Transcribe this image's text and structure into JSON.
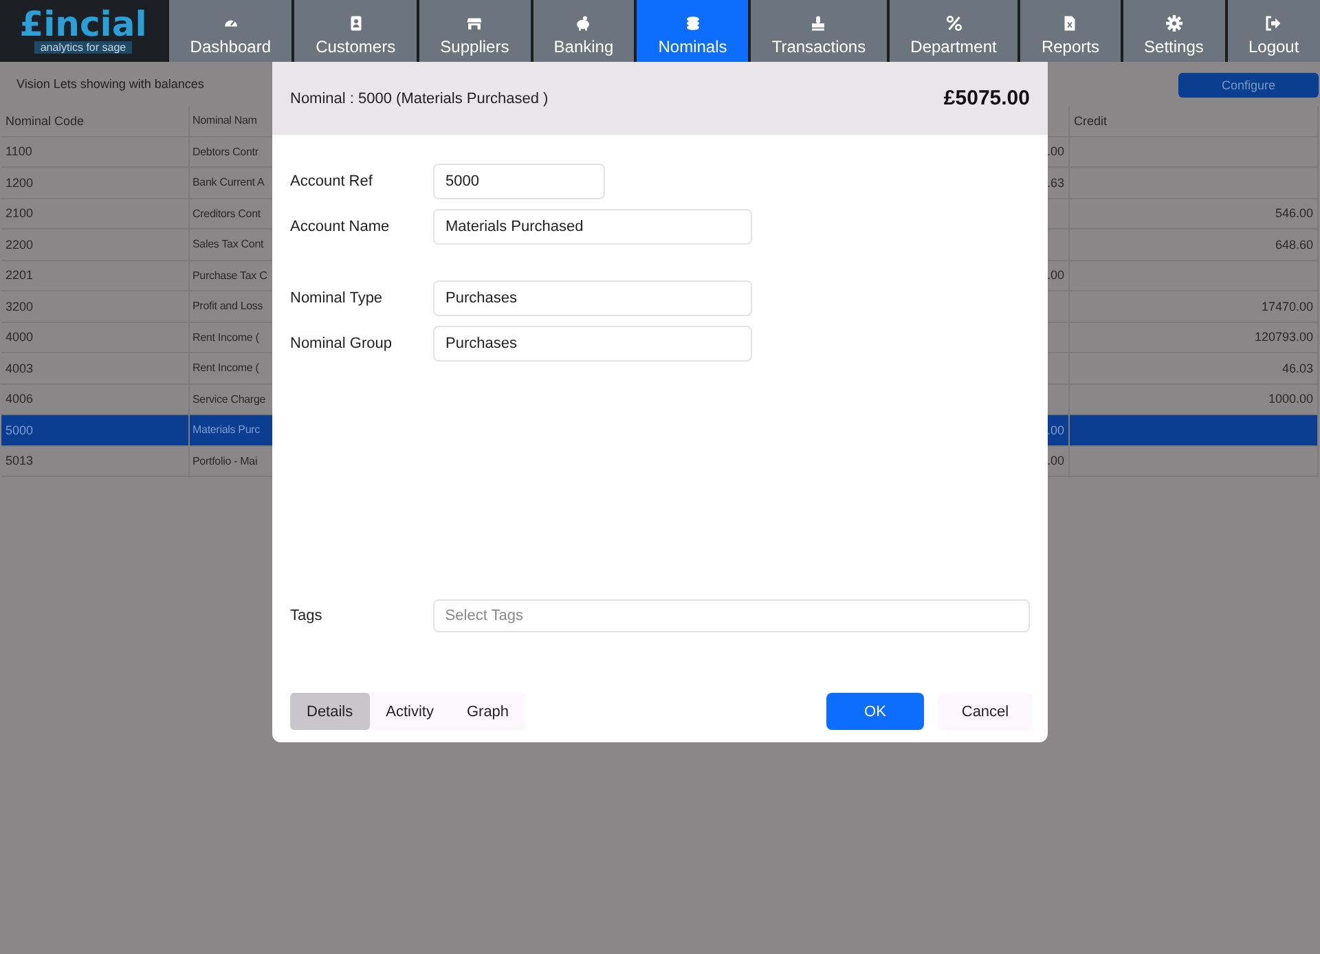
{
  "brand": {
    "name": "£incial",
    "tagline": "analytics for sage"
  },
  "nav": [
    {
      "label": "Dashboard",
      "selected": false
    },
    {
      "label": "Customers",
      "selected": false
    },
    {
      "label": "Suppliers",
      "selected": false
    },
    {
      "label": "Banking",
      "selected": false
    },
    {
      "label": "Nominals",
      "selected": true
    },
    {
      "label": "Transactions",
      "selected": false
    },
    {
      "label": "Department",
      "selected": false
    },
    {
      "label": "Reports",
      "selected": false
    },
    {
      "label": "Settings",
      "selected": false
    },
    {
      "label": "Logout",
      "selected": false
    }
  ],
  "toolbar": {
    "caption": "Vision Lets showing with balances",
    "button": "Configure"
  },
  "table": {
    "columns": [
      "Nominal Code",
      "Nominal Nam",
      "Credit"
    ],
    "rows": [
      {
        "code": "1100",
        "name": "Debtors Contr",
        "debit": ".00",
        "credit": "",
        "selected": false
      },
      {
        "code": "1200",
        "name": "Bank Current A",
        "debit": ".63",
        "credit": "",
        "selected": false
      },
      {
        "code": "2100",
        "name": "Creditors Cont",
        "debit": "",
        "credit": "546.00",
        "selected": false
      },
      {
        "code": "2200",
        "name": "Sales Tax Cont",
        "debit": "",
        "credit": "648.60",
        "selected": false
      },
      {
        "code": "2201",
        "name": "Purchase Tax C",
        "debit": ".00",
        "credit": "",
        "selected": false
      },
      {
        "code": "3200",
        "name": "Profit and Loss",
        "debit": "",
        "credit": "17470.00",
        "selected": false
      },
      {
        "code": "4000",
        "name": "Rent Income (",
        "debit": "",
        "credit": "120793.00",
        "selected": false
      },
      {
        "code": "4003",
        "name": "Rent Income (",
        "debit": "",
        "credit": "46.03",
        "selected": false
      },
      {
        "code": "4006",
        "name": "Service Charge",
        "debit": "",
        "credit": "1000.00",
        "selected": false
      },
      {
        "code": "5000",
        "name": "Materials Purc",
        "debit": ".00",
        "credit": "",
        "selected": true
      },
      {
        "code": "5013",
        "name": "Portfolio - Mai",
        "debit": ".00",
        "credit": "",
        "selected": false
      }
    ]
  },
  "dialog": {
    "title": "Nominal : 5000 (Materials Purchased )",
    "amount": "£5075.00",
    "fields": [
      {
        "label": "Account Ref",
        "value": "5000"
      },
      {
        "label": "Account Name",
        "value": "Materials Purchased"
      },
      {
        "label": "Nominal Type",
        "value": "Purchases"
      },
      {
        "label": "Nominal Group",
        "value": "Purchases"
      }
    ],
    "tags": {
      "label": "Tags",
      "placeholder": "Select Tags"
    },
    "tabs": [
      {
        "label": "Details",
        "selected": true
      },
      {
        "label": "Activity",
        "selected": false
      },
      {
        "label": "Graph",
        "selected": false
      }
    ],
    "ok": "OK",
    "cancel": "Cancel"
  }
}
